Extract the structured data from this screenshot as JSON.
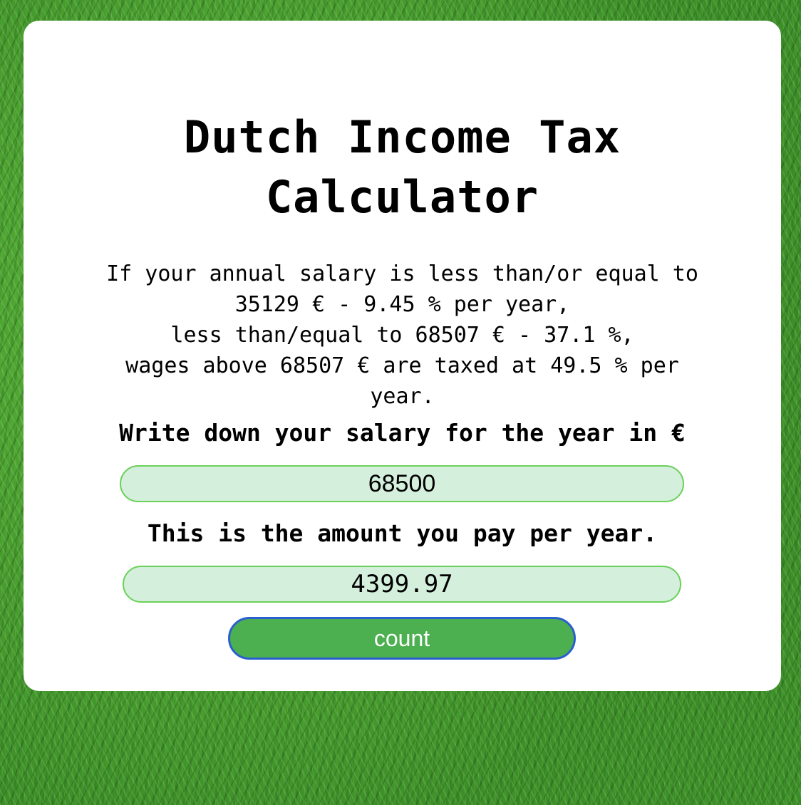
{
  "page": {
    "title_line1": "Dutch Income Tax",
    "title_line2": "Calculator"
  },
  "info": {
    "line1": "If your annual salary is less than/or equal to",
    "line2": "35129 € - 9.45 % per year,",
    "line3": "less than/equal to 68507 € - 37.1 %,",
    "line4": "wages above 68507 € are taxed at 49.5 % per",
    "line5": "year."
  },
  "salary": {
    "label": "Write down your salary for the year in €",
    "value": "68500"
  },
  "result": {
    "label": "This is the amount you pay per year.",
    "value": "4399.97"
  },
  "actions": {
    "count_label": "count"
  },
  "colors": {
    "card_background": "#ffffff",
    "field_background": "#d4efdb",
    "field_border": "#6ad15a",
    "button_background": "#4caf50",
    "button_border": "#2a5fcf",
    "button_text": "#ffffff"
  }
}
